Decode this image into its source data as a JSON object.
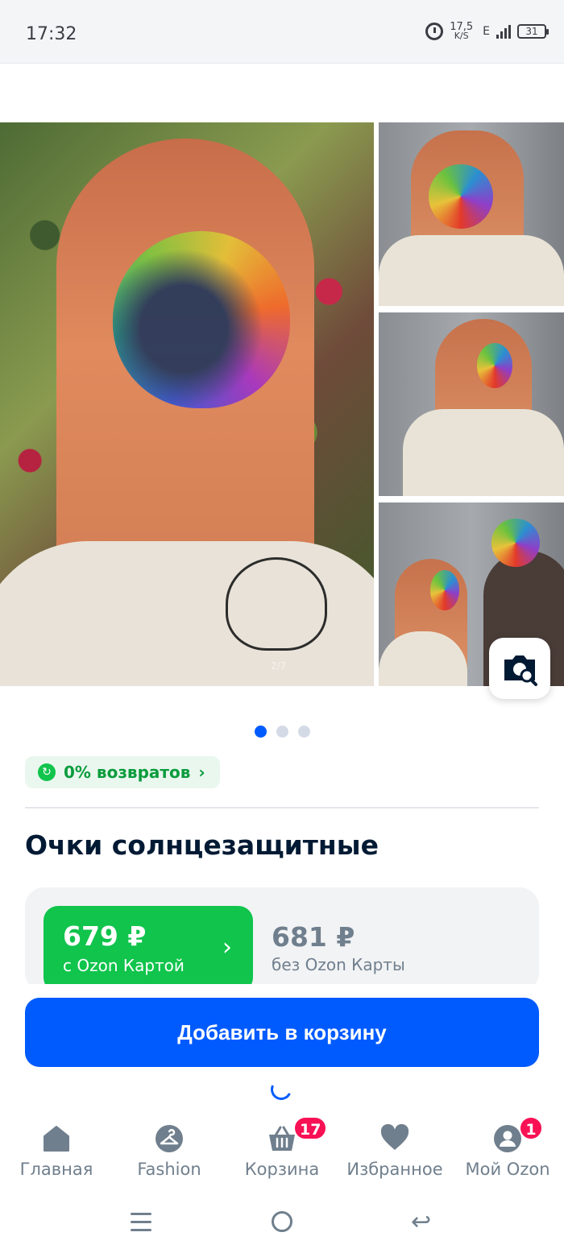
{
  "status_bar": {
    "time": "17:32",
    "net_speed_value": "17,5",
    "net_speed_unit": "K/S",
    "network_type": "E",
    "battery": "31"
  },
  "gallery": {
    "photo_counter": "2/7",
    "page_dots": 3,
    "active_dot_index": 0
  },
  "returns_badge": {
    "label": "0% возвратов",
    "icon": "return-arrow-icon"
  },
  "product": {
    "title": "Очки солнцезащитные"
  },
  "price": {
    "card_price": "679 ₽",
    "card_price_note": "с Ozon Картой",
    "regular_price": "681 ₽",
    "regular_price_note": "без Ozon Карты"
  },
  "actions": {
    "add_to_cart": "Добавить в корзину"
  },
  "tab_bar": {
    "items": [
      {
        "label": "Главная",
        "icon": "home-icon"
      },
      {
        "label": "Fashion",
        "icon": "hanger-icon"
      },
      {
        "label": "Корзина",
        "icon": "basket-icon",
        "badge": "17"
      },
      {
        "label": "Избранное",
        "icon": "heart-icon"
      },
      {
        "label": "Мой Ozon",
        "icon": "profile-icon",
        "badge": "1"
      }
    ]
  },
  "colors": {
    "brand_blue": "#005bff",
    "ozon_card_green": "#10c44c",
    "badge_pink": "#f91155",
    "muted_gray": "#707f8d"
  }
}
